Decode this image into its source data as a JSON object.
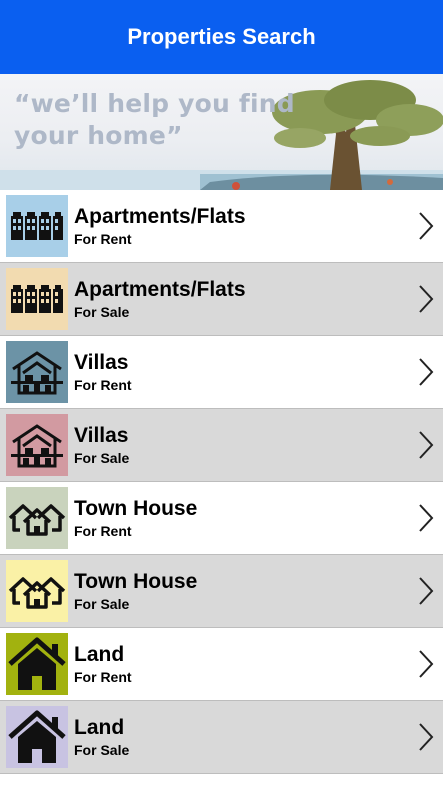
{
  "app": {
    "title": "Properties Search"
  },
  "banner": {
    "line1": "“we’ll help you find",
    "line2": "your home”"
  },
  "colors": {
    "header": "#0a5ff0",
    "row_alt": "#d9d9d9",
    "row_plain": "#ffffff"
  },
  "categories": [
    {
      "title": "Apartments/Flats",
      "subtitle": "For Rent",
      "icon": "apartment-building-icon",
      "icon_bg": "#a8cfe8"
    },
    {
      "title": "Apartments/Flats",
      "subtitle": "For Sale",
      "icon": "apartment-building-icon",
      "icon_bg": "#f2dbb0"
    },
    {
      "title": "Villas",
      "subtitle": "For Rent",
      "icon": "villa-icon",
      "icon_bg": "#6c93a6"
    },
    {
      "title": "Villas",
      "subtitle": "For Sale",
      "icon": "villa-icon",
      "icon_bg": "#d29aa1"
    },
    {
      "title": "Town House",
      "subtitle": "For Rent",
      "icon": "town-house-icon",
      "icon_bg": "#c9d3bd"
    },
    {
      "title": "Town House",
      "subtitle": "For Sale",
      "icon": "town-house-icon",
      "icon_bg": "#faf1a6"
    },
    {
      "title": "Land",
      "subtitle": "For Rent",
      "icon": "land-house-icon",
      "icon_bg": "#a2b20f"
    },
    {
      "title": "Land",
      "subtitle": "For Sale",
      "icon": "land-house-icon",
      "icon_bg": "#c8c3e2"
    }
  ]
}
